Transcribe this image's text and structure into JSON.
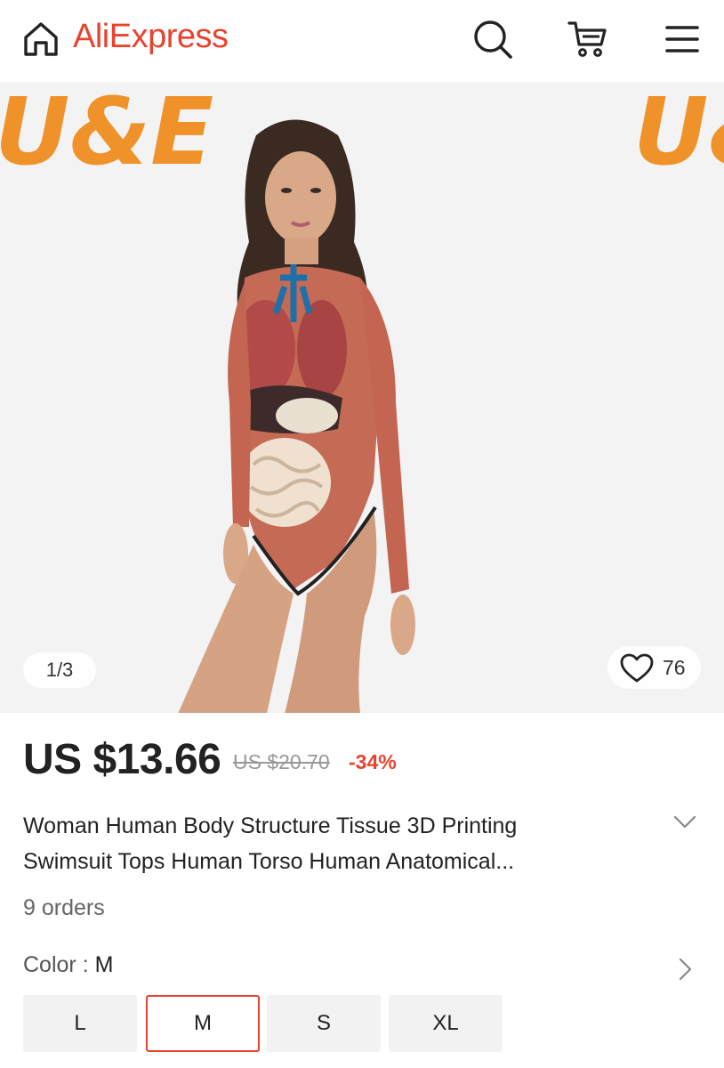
{
  "header": {
    "logo_text": "AliExpress",
    "icons": [
      "home-icon",
      "search-icon",
      "cart-icon",
      "menu-icon"
    ]
  },
  "gallery": {
    "watermark_main": "U&E",
    "watermark_next": "U&",
    "slide_counter": "1/3",
    "wishlist_count": "76"
  },
  "product": {
    "price": "US $13.66",
    "original_price": "US $20.70",
    "discount": "-34%",
    "title": "Woman Human Body Structure Tissue 3D Printing Swimsuit Tops Human Torso Human Anatomical...",
    "orders": "9 orders"
  },
  "variants": {
    "color_label": "Color",
    "color_separator": " : ",
    "color_selected": "M",
    "sizes": [
      {
        "label": "L",
        "selected": false
      },
      {
        "label": "M",
        "selected": true
      },
      {
        "label": "S",
        "selected": false
      },
      {
        "label": "XL",
        "selected": false
      }
    ]
  },
  "colors": {
    "brand": "#e8432e",
    "watermark": "#f0922a",
    "background": "#f3f3f3"
  }
}
